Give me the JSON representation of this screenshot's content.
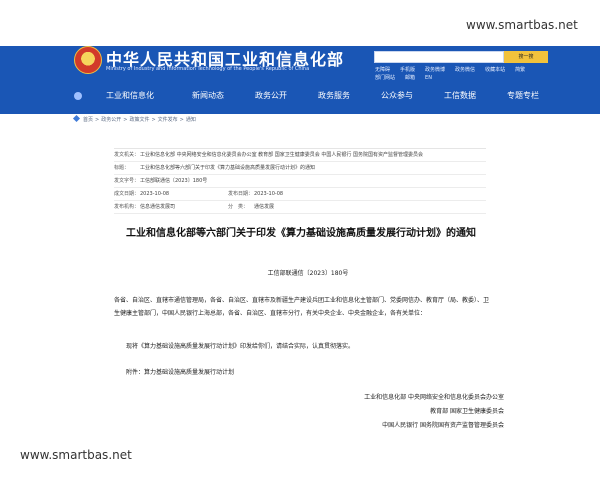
{
  "header": {
    "site_title": "中华人民共和国工业和信息化部",
    "site_subtitle": "Ministry of Industry and Information Technology of the People's Republic of China",
    "search_button": "搜一搜",
    "top_links_row1": [
      "无障碍",
      "手机版",
      "政务微博",
      "政务微信",
      "收藏本站",
      "简繁"
    ],
    "top_links_row2": [
      "部门网站",
      "邮箱",
      "EN"
    ]
  },
  "nav": {
    "items": [
      "工业和信息化",
      "新闻动态",
      "政务公开",
      "政务服务",
      "公众参与",
      "工信数据",
      "专题专栏"
    ]
  },
  "watermarks": {
    "top": "www.smartbas.net",
    "bottom": "www.smartbas.net"
  },
  "breadcrumb": [
    "首页",
    "政务公开",
    "政策文件",
    "文件发布",
    "通知"
  ],
  "meta": {
    "issuer_label": "发文机关：",
    "issuer_value": "工业和信息化部 中央网络安全和信息化委员会办公室 教育部 国家卫生健康委员会 中国人民银行 国务院国有资产监督管理委员会",
    "title_label": "标题：",
    "title_value": "工业和信息化部等六部门关于印发《算力基础设施高质量发展行动计划》的通知",
    "docno_label": "发文字号：",
    "docno_value": "工信部联通信〔2023〕180号",
    "created_label": "成文日期：",
    "created_value": "2023-10-08",
    "published_label": "发布日期：",
    "published_value": "2023-10-08",
    "org_label": "发布机构：",
    "org_value": "信息通信发展司",
    "category_label": "分　类：",
    "category_value": "通信发展"
  },
  "document": {
    "title": "工业和信息化部等六部门关于印发《算力基础设施高质量发展行动计划》的通知",
    "number": "工信部联通信〔2023〕180号",
    "addressee": "各省、自治区、直辖市通信管理局，各省、自治区、直辖市及新疆生产建设兵团工业和信息化主管部门、党委网信办、教育厅（局、教委）、卫生健康主管部门，中国人民银行上海总部，各省、自治区、直辖市分行，有关中央企业、中央金融企业，各有关单位：",
    "notice": "现将《算力基础设施高质量发展行动计划》印发给你们，请结合实际，认真贯彻落实。",
    "attachment": "附件：算力基础设施高质量发展行动计划",
    "signatures": [
      "工业和信息化部  中央网络安全和信息化委员会办公室",
      "教育部  国家卫生健康委员会",
      "中国人民银行  国务院国有资产监督管理委员会"
    ]
  }
}
